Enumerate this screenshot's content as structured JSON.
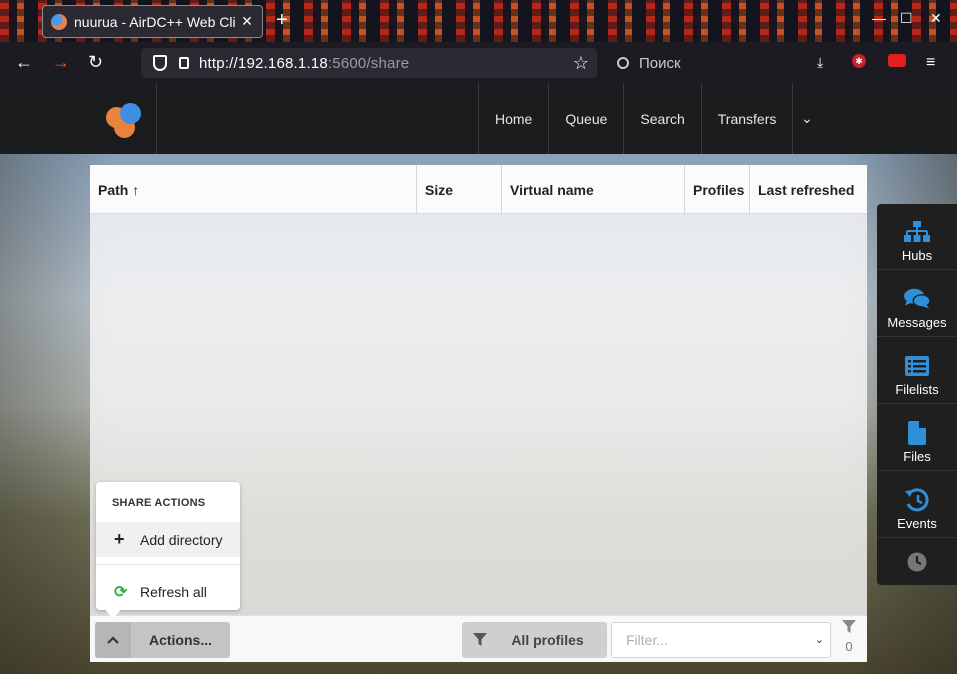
{
  "browser": {
    "tab_title": "nuurua - AirDC++ Web Cli",
    "tab_close": "✕",
    "new_tab": "+",
    "url_host": "http://192.168.1.18",
    "url_rest": ":5600/share",
    "search_placeholder": "Поиск",
    "window_controls": [
      "—",
      "☐",
      "✕"
    ]
  },
  "header": {
    "nav": [
      "Home",
      "Queue",
      "Search",
      "Transfers"
    ],
    "caret": "⌄"
  },
  "table": {
    "columns": [
      "Path ↑",
      "Size",
      "Virtual name",
      "Profiles",
      "Last refreshed"
    ]
  },
  "popup": {
    "header": "SHARE ACTIONS",
    "add_label": "Add directory",
    "refresh_label": "Refresh all"
  },
  "footer": {
    "actions_label": "Actions...",
    "profiles_label": "All profiles",
    "filter_placeholder": "Filter...",
    "filter_count": "0"
  },
  "sidebar": {
    "items": [
      {
        "label": "Hubs",
        "icon": "sitemap-icon"
      },
      {
        "label": "Messages",
        "icon": "comments-icon"
      },
      {
        "label": "Filelists",
        "icon": "list-icon"
      },
      {
        "label": "Files",
        "icon": "file-icon"
      },
      {
        "label": "Events",
        "icon": "history-icon"
      }
    ],
    "accent": "#2f8fd8"
  }
}
